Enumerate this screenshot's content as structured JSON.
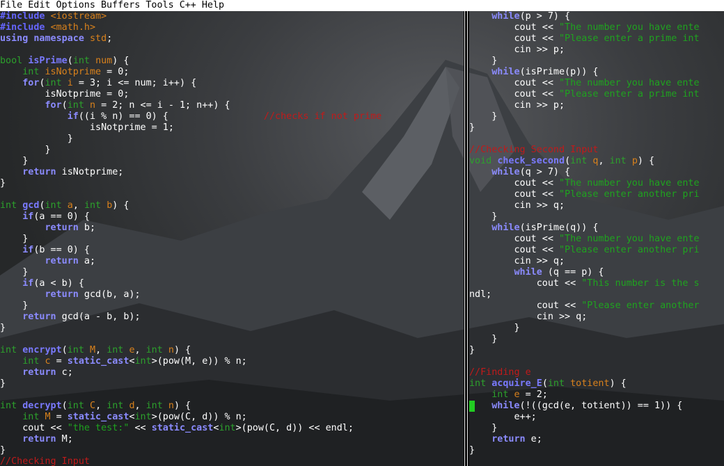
{
  "menu": {
    "items": [
      "File",
      "Edit",
      "Options",
      "Buffers",
      "Tools",
      "C++",
      "Help"
    ]
  },
  "left_pane": {
    "lines": [
      [
        [
          "pp",
          "#include "
        ],
        [
          "ppv",
          "<iostream>"
        ]
      ],
      [
        [
          "pp",
          "#include "
        ],
        [
          "ppv",
          "<math.h>"
        ]
      ],
      [
        [
          "kw",
          "using namespace "
        ],
        [
          "var",
          "std"
        ],
        [
          "t",
          ";"
        ]
      ],
      [],
      [
        [
          "type",
          "bool "
        ],
        [
          "fn",
          "isPrime"
        ],
        [
          "t",
          "("
        ],
        [
          "type",
          "int "
        ],
        [
          "var",
          "num"
        ],
        [
          "t",
          ") {"
        ]
      ],
      [
        [
          "t",
          "    "
        ],
        [
          "type",
          "int "
        ],
        [
          "var",
          "isNotprime"
        ],
        [
          "t",
          " = 0;"
        ]
      ],
      [
        [
          "t",
          "    "
        ],
        [
          "kw",
          "for"
        ],
        [
          "t",
          "("
        ],
        [
          "type",
          "int "
        ],
        [
          "var",
          "i"
        ],
        [
          "t",
          " = 3; i <= num; i++) {"
        ]
      ],
      [
        [
          "t",
          "        isNotprime = 0;"
        ]
      ],
      [
        [
          "t",
          "        "
        ],
        [
          "kw",
          "for"
        ],
        [
          "t",
          "("
        ],
        [
          "type",
          "int "
        ],
        [
          "var",
          "n"
        ],
        [
          "t",
          " = 2; n <= i - 1; n++) {"
        ]
      ],
      [
        [
          "t",
          "            "
        ],
        [
          "kw",
          "if"
        ],
        [
          "t",
          "((i % n) == 0) {                 "
        ],
        [
          "cmt",
          "//checks if not prime"
        ]
      ],
      [
        [
          "t",
          "                isNotprime = 1;"
        ]
      ],
      [
        [
          "t",
          "            }"
        ]
      ],
      [
        [
          "t",
          "        }"
        ]
      ],
      [
        [
          "t",
          "    }"
        ]
      ],
      [
        [
          "t",
          "    "
        ],
        [
          "kw",
          "return"
        ],
        [
          "t",
          " isNotprime;"
        ]
      ],
      [
        [
          "t",
          "}"
        ]
      ],
      [],
      [
        [
          "type",
          "int "
        ],
        [
          "fn",
          "gcd"
        ],
        [
          "t",
          "("
        ],
        [
          "type",
          "int "
        ],
        [
          "var",
          "a"
        ],
        [
          "t",
          ", "
        ],
        [
          "type",
          "int "
        ],
        [
          "var",
          "b"
        ],
        [
          "t",
          ") {"
        ]
      ],
      [
        [
          "t",
          "    "
        ],
        [
          "kw",
          "if"
        ],
        [
          "t",
          "(a == 0) {"
        ]
      ],
      [
        [
          "t",
          "        "
        ],
        [
          "kw",
          "return"
        ],
        [
          "t",
          " b;"
        ]
      ],
      [
        [
          "t",
          "    }"
        ]
      ],
      [
        [
          "t",
          "    "
        ],
        [
          "kw",
          "if"
        ],
        [
          "t",
          "(b == 0) {"
        ]
      ],
      [
        [
          "t",
          "        "
        ],
        [
          "kw",
          "return"
        ],
        [
          "t",
          " a;"
        ]
      ],
      [
        [
          "t",
          "    }"
        ]
      ],
      [
        [
          "t",
          "    "
        ],
        [
          "kw",
          "if"
        ],
        [
          "t",
          "(a < b) {"
        ]
      ],
      [
        [
          "t",
          "        "
        ],
        [
          "kw",
          "return"
        ],
        [
          "t",
          " gcd(b, a);"
        ]
      ],
      [
        [
          "t",
          "    }"
        ]
      ],
      [
        [
          "t",
          "    "
        ],
        [
          "kw",
          "return"
        ],
        [
          "t",
          " gcd(a - b, b);"
        ]
      ],
      [
        [
          "t",
          "}"
        ]
      ],
      [],
      [
        [
          "type",
          "int "
        ],
        [
          "fn",
          "encrypt"
        ],
        [
          "t",
          "("
        ],
        [
          "type",
          "int "
        ],
        [
          "var",
          "M"
        ],
        [
          "t",
          ", "
        ],
        [
          "type",
          "int "
        ],
        [
          "var",
          "e"
        ],
        [
          "t",
          ", "
        ],
        [
          "type",
          "int "
        ],
        [
          "var",
          "n"
        ],
        [
          "t",
          ") {"
        ]
      ],
      [
        [
          "t",
          "    "
        ],
        [
          "type",
          "int "
        ],
        [
          "var",
          "c"
        ],
        [
          "t",
          " = "
        ],
        [
          "kw",
          "static_cast"
        ],
        [
          "t",
          "<"
        ],
        [
          "type",
          "int"
        ],
        [
          "t",
          ">(pow(M, e)) % n;"
        ]
      ],
      [
        [
          "t",
          "    "
        ],
        [
          "kw",
          "return"
        ],
        [
          "t",
          " c;"
        ]
      ],
      [
        [
          "t",
          "}"
        ]
      ],
      [],
      [
        [
          "type",
          "int "
        ],
        [
          "fn",
          "decrypt"
        ],
        [
          "t",
          "("
        ],
        [
          "type",
          "int "
        ],
        [
          "var",
          "C"
        ],
        [
          "t",
          ", "
        ],
        [
          "type",
          "int "
        ],
        [
          "var",
          "d"
        ],
        [
          "t",
          ", "
        ],
        [
          "type",
          "int "
        ],
        [
          "var",
          "n"
        ],
        [
          "t",
          ") {"
        ]
      ],
      [
        [
          "t",
          "    "
        ],
        [
          "type",
          "int "
        ],
        [
          "var",
          "M"
        ],
        [
          "t",
          " = "
        ],
        [
          "kw",
          "static_cast"
        ],
        [
          "t",
          "<"
        ],
        [
          "type",
          "int"
        ],
        [
          "t",
          ">(pow(C, d)) % n;"
        ]
      ],
      [
        [
          "t",
          "    cout << "
        ],
        [
          "str",
          "\"the test:\""
        ],
        [
          "t",
          " << "
        ],
        [
          "kw",
          "static_cast"
        ],
        [
          "t",
          "<"
        ],
        [
          "type",
          "int"
        ],
        [
          "t",
          ">(pow(C, d)) << endl;"
        ]
      ],
      [
        [
          "t",
          "    "
        ],
        [
          "kw",
          "return"
        ],
        [
          "t",
          " M;"
        ]
      ],
      [
        [
          "t",
          "}"
        ]
      ],
      [
        [
          "cmt",
          "//Checking Input"
        ]
      ]
    ]
  },
  "right_pane": {
    "lines": [
      [
        [
          "t",
          "    "
        ],
        [
          "kw",
          "while"
        ],
        [
          "t",
          "(p > 7) {"
        ]
      ],
      [
        [
          "t",
          "        cout << "
        ],
        [
          "str",
          "\"The number you have ente"
        ]
      ],
      [
        [
          "t",
          "        cout << "
        ],
        [
          "str",
          "\"Please enter a prime int"
        ]
      ],
      [
        [
          "t",
          "        cin >> p;"
        ]
      ],
      [
        [
          "t",
          "    }"
        ]
      ],
      [
        [
          "t",
          "    "
        ],
        [
          "kw",
          "while"
        ],
        [
          "t",
          "(isPrime(p)) {"
        ]
      ],
      [
        [
          "t",
          "        cout << "
        ],
        [
          "str",
          "\"The number you have ente"
        ]
      ],
      [
        [
          "t",
          "        cout << "
        ],
        [
          "str",
          "\"Please enter a prime int"
        ]
      ],
      [
        [
          "t",
          "        cin >> p;"
        ]
      ],
      [
        [
          "t",
          "    }"
        ]
      ],
      [
        [
          "t",
          "}"
        ]
      ],
      [],
      [
        [
          "cmt",
          "//Checking Second Input"
        ]
      ],
      [
        [
          "type",
          "void "
        ],
        [
          "fn",
          "check_second"
        ],
        [
          "t",
          "("
        ],
        [
          "type",
          "int "
        ],
        [
          "var",
          "q"
        ],
        [
          "t",
          ", "
        ],
        [
          "type",
          "int "
        ],
        [
          "var",
          "p"
        ],
        [
          "t",
          ") {"
        ]
      ],
      [
        [
          "t",
          "    "
        ],
        [
          "kw",
          "while"
        ],
        [
          "t",
          "(q > 7) {"
        ]
      ],
      [
        [
          "t",
          "        cout << "
        ],
        [
          "str",
          "\"The number you have ente"
        ]
      ],
      [
        [
          "t",
          "        cout << "
        ],
        [
          "str",
          "\"Please enter another pri"
        ]
      ],
      [
        [
          "t",
          "        cin >> q;"
        ]
      ],
      [
        [
          "t",
          "    }"
        ]
      ],
      [
        [
          "t",
          "    "
        ],
        [
          "kw",
          "while"
        ],
        [
          "t",
          "(isPrime(q)) {"
        ]
      ],
      [
        [
          "t",
          "        cout << "
        ],
        [
          "str",
          "\"The number you have ente"
        ]
      ],
      [
        [
          "t",
          "        cout << "
        ],
        [
          "str",
          "\"Please enter another pri"
        ]
      ],
      [
        [
          "t",
          "        cin >> q;"
        ]
      ],
      [
        [
          "t",
          "        "
        ],
        [
          "kw",
          "while"
        ],
        [
          "t",
          " (q == p) {"
        ]
      ],
      [
        [
          "t",
          "            cout << "
        ],
        [
          "str",
          "\"This number is the s"
        ]
      ],
      [
        [
          "t",
          "ndl;"
        ]
      ],
      [
        [
          "t",
          "            cout << "
        ],
        [
          "str",
          "\"Please enter another"
        ]
      ],
      [
        [
          "t",
          "            cin >> q;"
        ]
      ],
      [
        [
          "t",
          "        }"
        ]
      ],
      [
        [
          "t",
          "    }"
        ]
      ],
      [
        [
          "t",
          "}"
        ]
      ],
      [],
      [
        [
          "cmt",
          "//Finding e"
        ]
      ],
      [
        [
          "type",
          "int "
        ],
        [
          "fn",
          "acquire_E"
        ],
        [
          "t",
          "("
        ],
        [
          "type",
          "int "
        ],
        [
          "var",
          "totient"
        ],
        [
          "t",
          ") {"
        ]
      ],
      [
        [
          "t",
          "    "
        ],
        [
          "type",
          "int "
        ],
        [
          "var",
          "e"
        ],
        [
          "t",
          " = 2;"
        ]
      ],
      [
        [
          "cursor",
          ""
        ],
        [
          "t",
          "   "
        ],
        [
          "kw",
          "while"
        ],
        [
          "t",
          "(!((gcd(e, totient)) == 1)) {"
        ]
      ],
      [
        [
          "t",
          "        e++;"
        ]
      ],
      [
        [
          "t",
          "    }"
        ]
      ],
      [
        [
          "t",
          "    "
        ],
        [
          "kw",
          "return"
        ],
        [
          "t",
          " e;"
        ]
      ],
      [
        [
          "t",
          "}"
        ]
      ]
    ]
  }
}
